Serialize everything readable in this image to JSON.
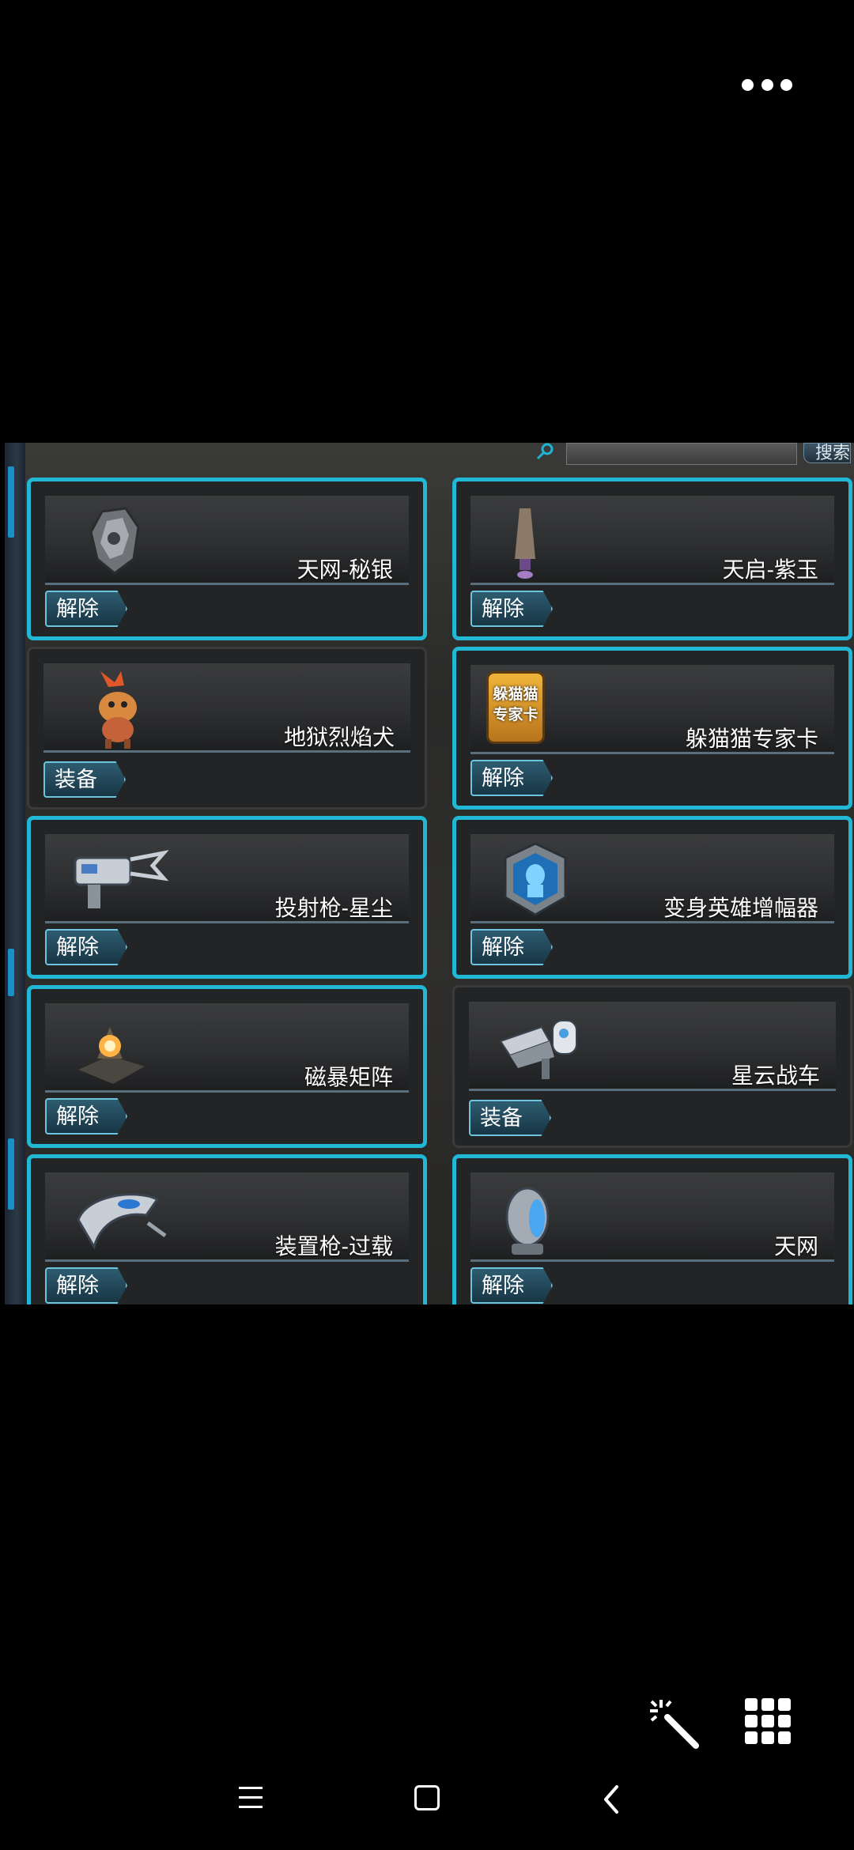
{
  "search": {
    "button_label": "搜索"
  },
  "items": [
    {
      "name": "天网-秘银",
      "action": "解除",
      "selected": true,
      "icon": "mithril-crystal-icon"
    },
    {
      "name": "天启-紫玉",
      "action": "解除",
      "selected": true,
      "icon": "purple-jade-totem-icon"
    },
    {
      "name": "地狱烈焰犬",
      "action": "装备",
      "selected": false,
      "icon": "hellfire-dog-pet-icon"
    },
    {
      "name": "躲猫猫专家卡",
      "action": "解除",
      "selected": true,
      "icon": "hide-and-seek-card-icon",
      "icon_text": "躲猫猫专家卡"
    },
    {
      "name": "投射枪-星尘",
      "action": "解除",
      "selected": true,
      "icon": "projector-gun-icon"
    },
    {
      "name": "变身英雄增幅器",
      "action": "解除",
      "selected": true,
      "icon": "hero-amplifier-badge-icon"
    },
    {
      "name": "磁暴矩阵",
      "action": "解除",
      "selected": true,
      "icon": "magnetic-storm-matrix-icon"
    },
    {
      "name": "星云战车",
      "action": "装备",
      "selected": false,
      "icon": "nebula-chariot-icon"
    },
    {
      "name": "装置枪-过载",
      "action": "解除",
      "selected": true,
      "icon": "overload-device-gun-icon"
    },
    {
      "name": "天网",
      "action": "解除",
      "selected": true,
      "icon": "skynet-mech-icon"
    }
  ],
  "colors": {
    "selected_border": "#21b8d6",
    "button_fill": "#183645"
  }
}
